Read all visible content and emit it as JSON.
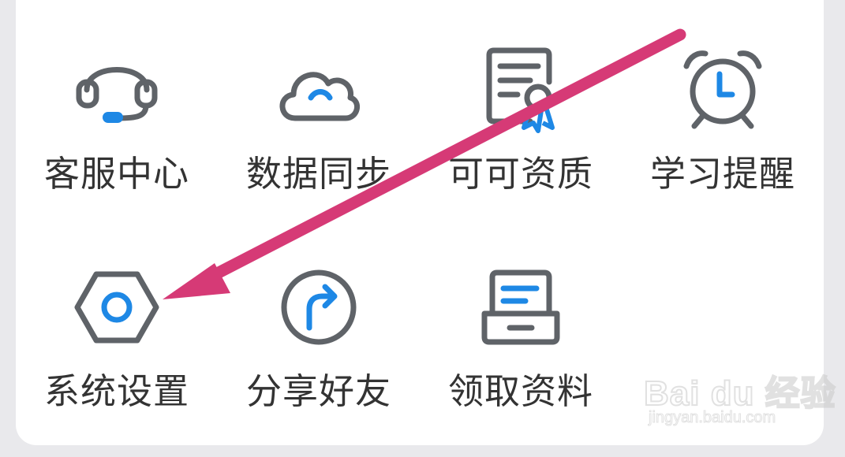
{
  "colors": {
    "icon_gray": "#5f6368",
    "icon_blue": "#1e88e5",
    "label_text": "#333333",
    "arrow": "#d63a76",
    "card_bg": "#ffffff",
    "page_bg": "#e9e9ec"
  },
  "menu": {
    "items": [
      {
        "label": "客服中心",
        "icon": "headset-icon"
      },
      {
        "label": "数据同步",
        "icon": "cloud-sync-icon"
      },
      {
        "label": "可可资质",
        "icon": "certificate-icon"
      },
      {
        "label": "学习提醒",
        "icon": "alarm-clock-icon"
      },
      {
        "label": "系统设置",
        "icon": "hexagon-settings-icon"
      },
      {
        "label": "分享好友",
        "icon": "share-arrow-icon"
      },
      {
        "label": "领取资料",
        "icon": "inbox-tray-icon"
      }
    ]
  },
  "annotation": {
    "type": "pointer-arrow",
    "target": "系统设置"
  },
  "watermark": {
    "brand": "Bai du 经验",
    "url": "jingyan.baidu.com"
  }
}
